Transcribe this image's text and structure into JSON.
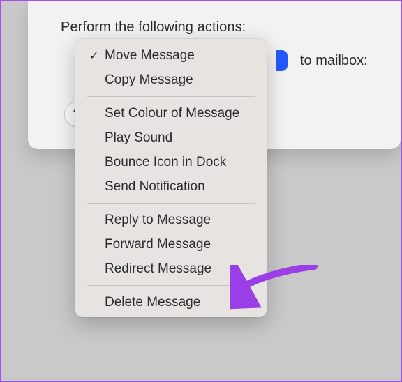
{
  "header": {
    "label": "Perform the following actions:"
  },
  "row": {
    "right_label": "to mailbox:",
    "help_label": "?"
  },
  "menu": {
    "items": [
      {
        "label": "Move Message",
        "checked": true
      },
      {
        "label": "Copy Message",
        "checked": false
      }
    ],
    "group2": [
      {
        "label": "Set Colour of Message"
      },
      {
        "label": "Play Sound"
      },
      {
        "label": "Bounce Icon in Dock"
      },
      {
        "label": "Send Notification"
      }
    ],
    "group3": [
      {
        "label": "Reply to Message"
      },
      {
        "label": "Forward Message"
      },
      {
        "label": "Redirect Message"
      }
    ],
    "group4": [
      {
        "label": "Delete Message"
      }
    ]
  },
  "annotation": {
    "arrow_color": "#9a3fe6"
  }
}
